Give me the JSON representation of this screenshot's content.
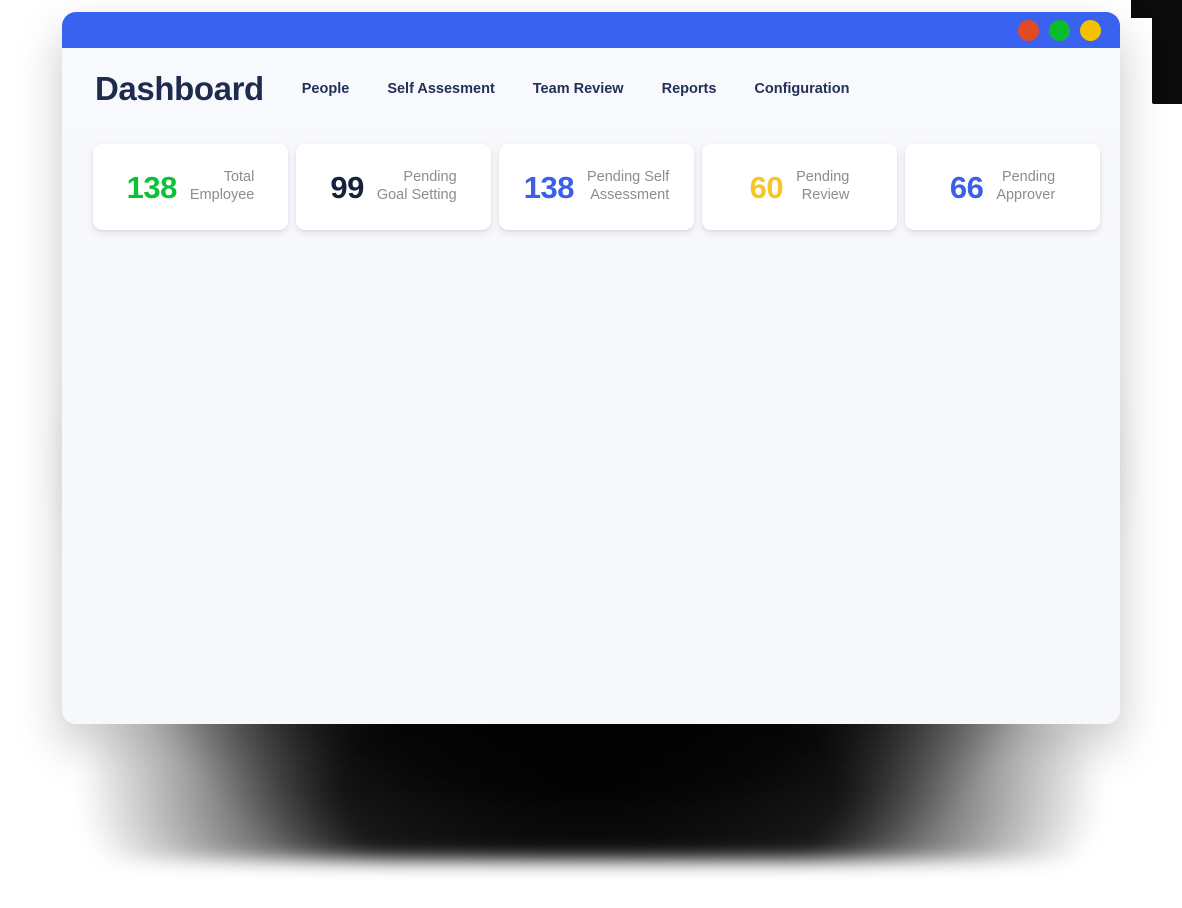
{
  "window": {
    "titlebar": {
      "buttons": [
        {
          "name": "close-button",
          "icon": "close-dot",
          "color": "#e04b25"
        },
        {
          "name": "minimize-button",
          "icon": "minimize-dot",
          "color": "#0bbd2e"
        },
        {
          "name": "maximize-button",
          "icon": "maximize-dot",
          "color": "#f5c000"
        }
      ],
      "bar_color": "#3a62f0"
    }
  },
  "header": {
    "title": "Dashboard",
    "nav": [
      {
        "label": "People"
      },
      {
        "label": "Self Assesment"
      },
      {
        "label": "Team Review"
      },
      {
        "label": "Reports"
      },
      {
        "label": "Configuration"
      }
    ]
  },
  "stats": [
    {
      "value": "138",
      "label": "Total\nEmployee",
      "color": "#0ac235"
    },
    {
      "value": "99",
      "label": "Pending\nGoal Setting",
      "color": "#16213e"
    },
    {
      "value": "138",
      "label": "Pending Self\nAssessment",
      "color": "#3a60ea"
    },
    {
      "value": "60",
      "label": "Pending\nReview",
      "color": "#f5c52a"
    },
    {
      "value": "66",
      "label": "Pending\nApprover",
      "color": "#3a60ea"
    }
  ]
}
